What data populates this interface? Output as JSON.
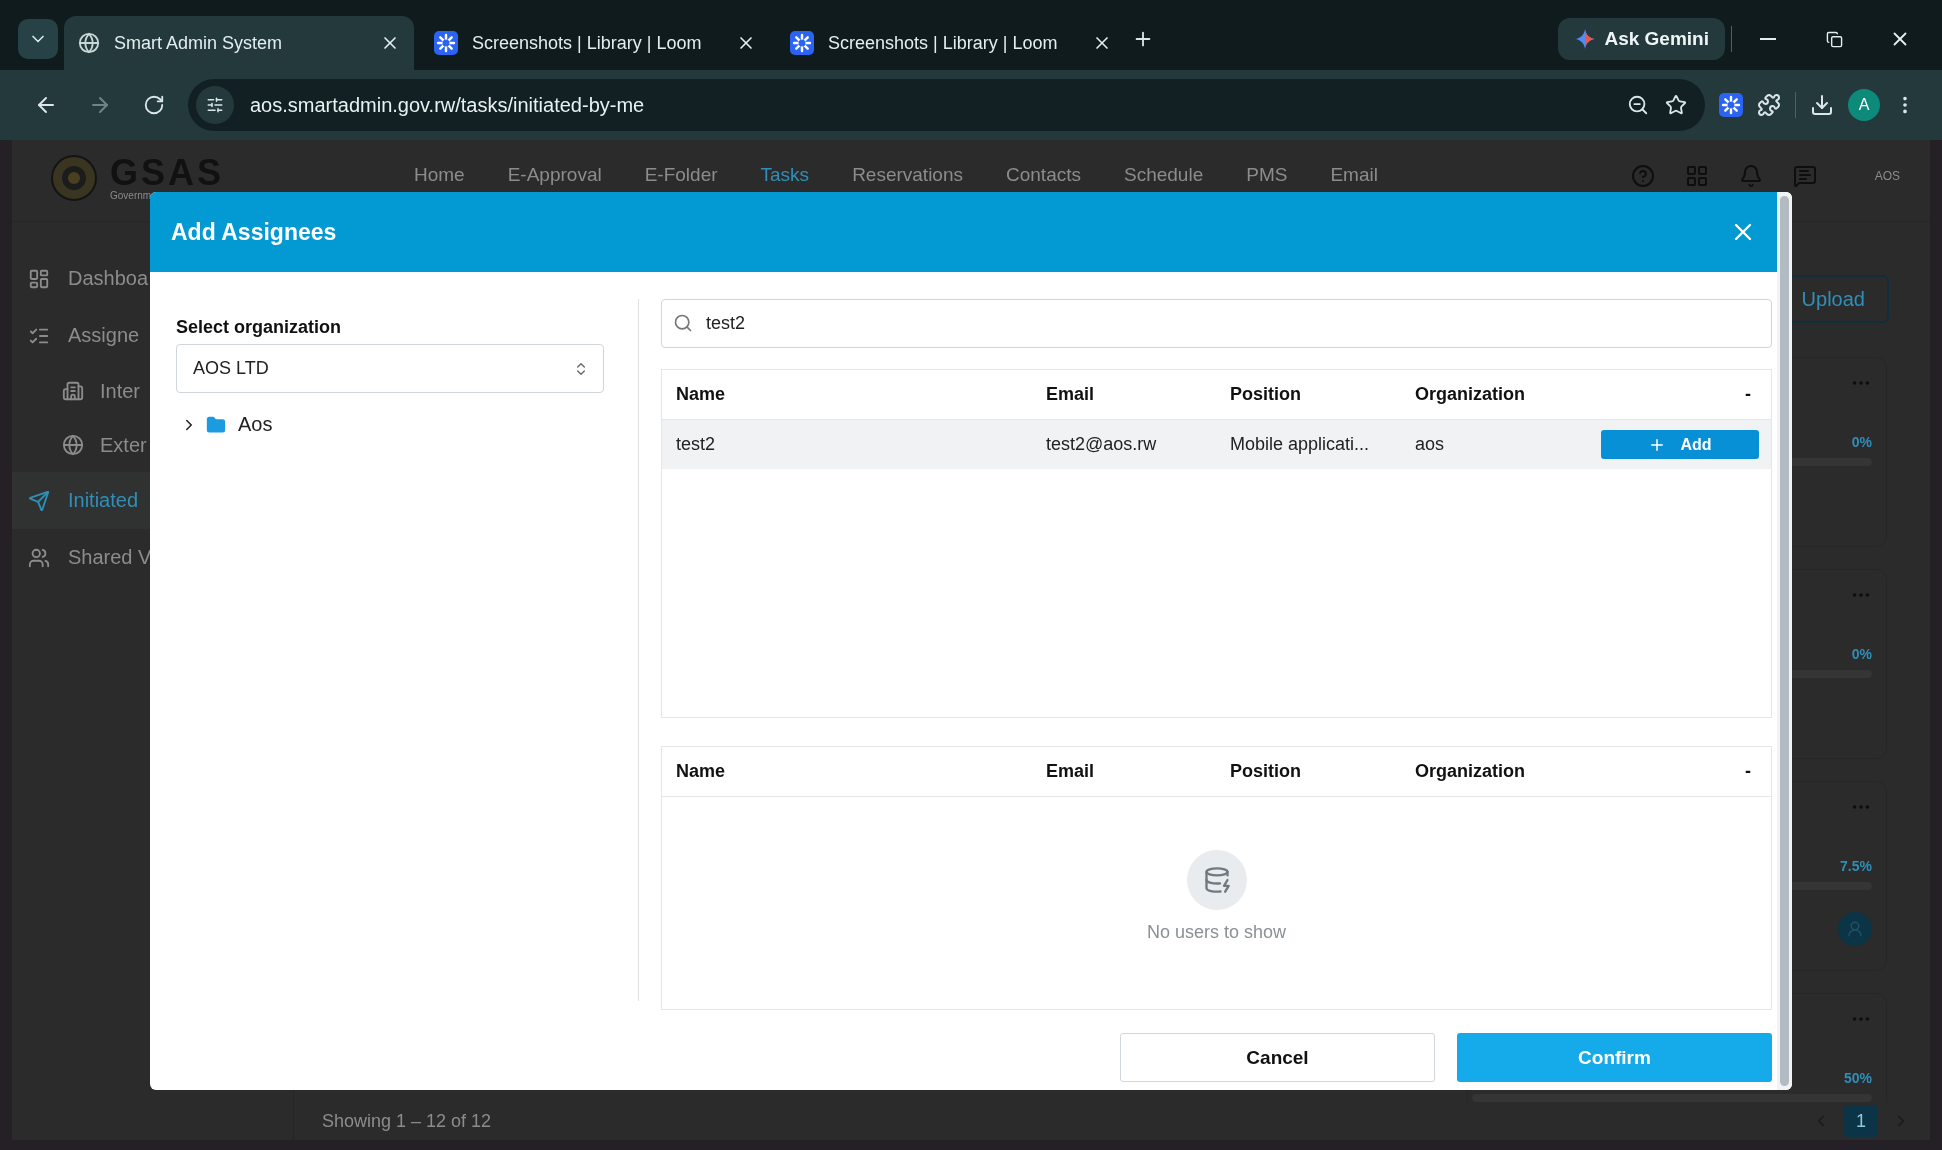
{
  "browser": {
    "tabs": [
      {
        "title": "Smart Admin System",
        "selected": true
      },
      {
        "title": "Screenshots | Library | Loom",
        "selected": false
      },
      {
        "title": "Screenshots | Library | Loom",
        "selected": false
      }
    ],
    "ask_button": "Ask Gemini",
    "url": "aos.smartadmin.gov.rw/tasks/initiated-by-me",
    "profile": "A"
  },
  "app": {
    "logo": "GSAS",
    "logo_subtitle": "Governm",
    "nav": [
      {
        "label": "Home",
        "selected": false
      },
      {
        "label": "E-Approval",
        "selected": false
      },
      {
        "label": "E-Folder",
        "selected": false
      },
      {
        "label": "Tasks",
        "selected": true
      },
      {
        "label": "Reservations",
        "selected": false
      },
      {
        "label": "Contacts",
        "selected": false
      },
      {
        "label": "Schedule",
        "selected": false
      },
      {
        "label": "PMS",
        "selected": false
      },
      {
        "label": "Email",
        "selected": false
      }
    ],
    "user": "AOS",
    "sidebar": [
      {
        "label": "Dashboa",
        "selected": false
      },
      {
        "label": "Assigne",
        "selected": false,
        "children": [
          {
            "label": "Inter",
            "selected": false
          },
          {
            "label": "Exter",
            "selected": false
          }
        ]
      },
      {
        "label": "Initiated",
        "selected": true
      },
      {
        "label": "Shared V",
        "selected": false
      }
    ],
    "upload_button": "Upload",
    "cards": [
      {
        "percent": "0%",
        "assignee_icon": false
      },
      {
        "percent": "0%",
        "assignee_icon": false
      },
      {
        "percent": "7.5%",
        "assignee_icon": true
      },
      {
        "percent": "50%",
        "assignee_icon": false
      }
    ],
    "footer": {
      "summary": "Showing 1 – 12 of 12",
      "pages": [
        {
          "label": "1",
          "selected": true
        }
      ]
    }
  },
  "modal": {
    "title": "Add Assignees",
    "org_label": "Select organization",
    "org_value": "AOS LTD",
    "tree": [
      {
        "label": "Aos",
        "expanded": false
      }
    ],
    "search": {
      "value": "test2"
    },
    "results": {
      "columns": [
        "Name",
        "Email",
        "Position",
        "Organization",
        "-"
      ],
      "rows": [
        {
          "cells": [
            "test2",
            "test2@aos.rw",
            "Mobile applicati...",
            "aos"
          ],
          "action": "Add"
        }
      ]
    },
    "selected": {
      "columns": [
        "Name",
        "Email",
        "Position",
        "Organization",
        "-"
      ],
      "empty_text": "No users to show"
    },
    "buttons": {
      "cancel": "Cancel",
      "confirm": "Confirm"
    }
  }
}
